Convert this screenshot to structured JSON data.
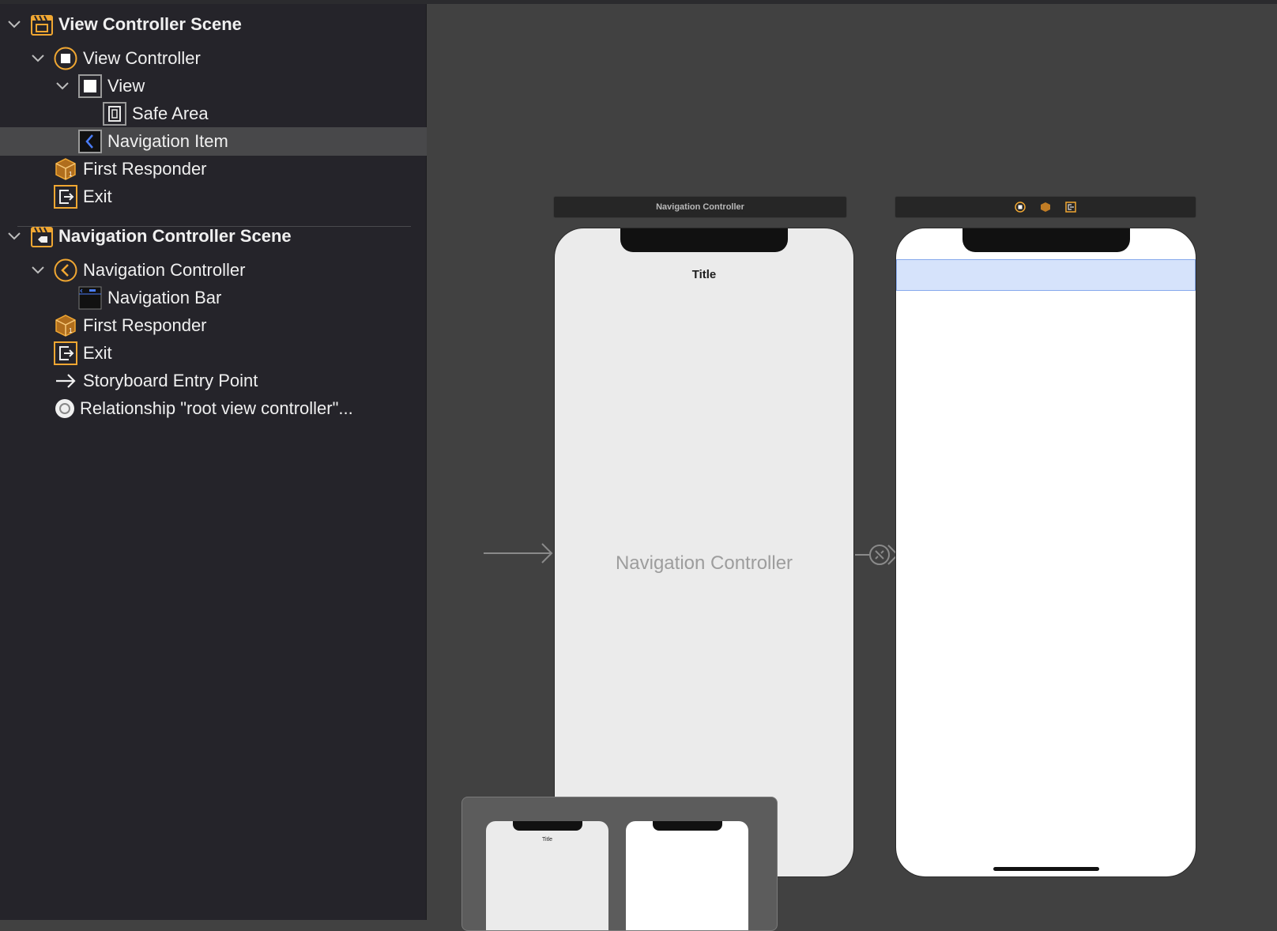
{
  "outline": {
    "scenes": [
      {
        "title": "View Controller Scene",
        "items": [
          {
            "label": "View Controller",
            "icon": "view-controller-icon"
          },
          {
            "label": "View",
            "icon": "view-icon"
          },
          {
            "label": "Safe Area",
            "icon": "safe-area-icon"
          },
          {
            "label": "Navigation Item",
            "icon": "navigation-item-icon",
            "selected": true
          },
          {
            "label": "First Responder",
            "icon": "first-responder-icon"
          },
          {
            "label": "Exit",
            "icon": "exit-icon"
          }
        ]
      },
      {
        "title": "Navigation Controller Scene",
        "items": [
          {
            "label": "Navigation Controller",
            "icon": "navigation-controller-icon"
          },
          {
            "label": "Navigation Bar",
            "icon": "navigation-bar-icon"
          },
          {
            "label": "First Responder",
            "icon": "first-responder-icon"
          },
          {
            "label": "Exit",
            "icon": "exit-icon"
          },
          {
            "label": "Storyboard Entry Point",
            "icon": "arrow-right-icon"
          },
          {
            "label": "Relationship \"root view controller\"...",
            "icon": "relationship-icon"
          }
        ]
      }
    ]
  },
  "canvas": {
    "nav_scene_bar_title": "Navigation Controller",
    "nav_title": "Title",
    "nav_watermark": "Navigation Controller",
    "mini_title": "Title"
  },
  "colors": {
    "accent_orange": "#f0a732",
    "selection_blue": "#d6e3fb",
    "sidebar_bg": "#25242a",
    "canvas_bg": "#414141"
  }
}
